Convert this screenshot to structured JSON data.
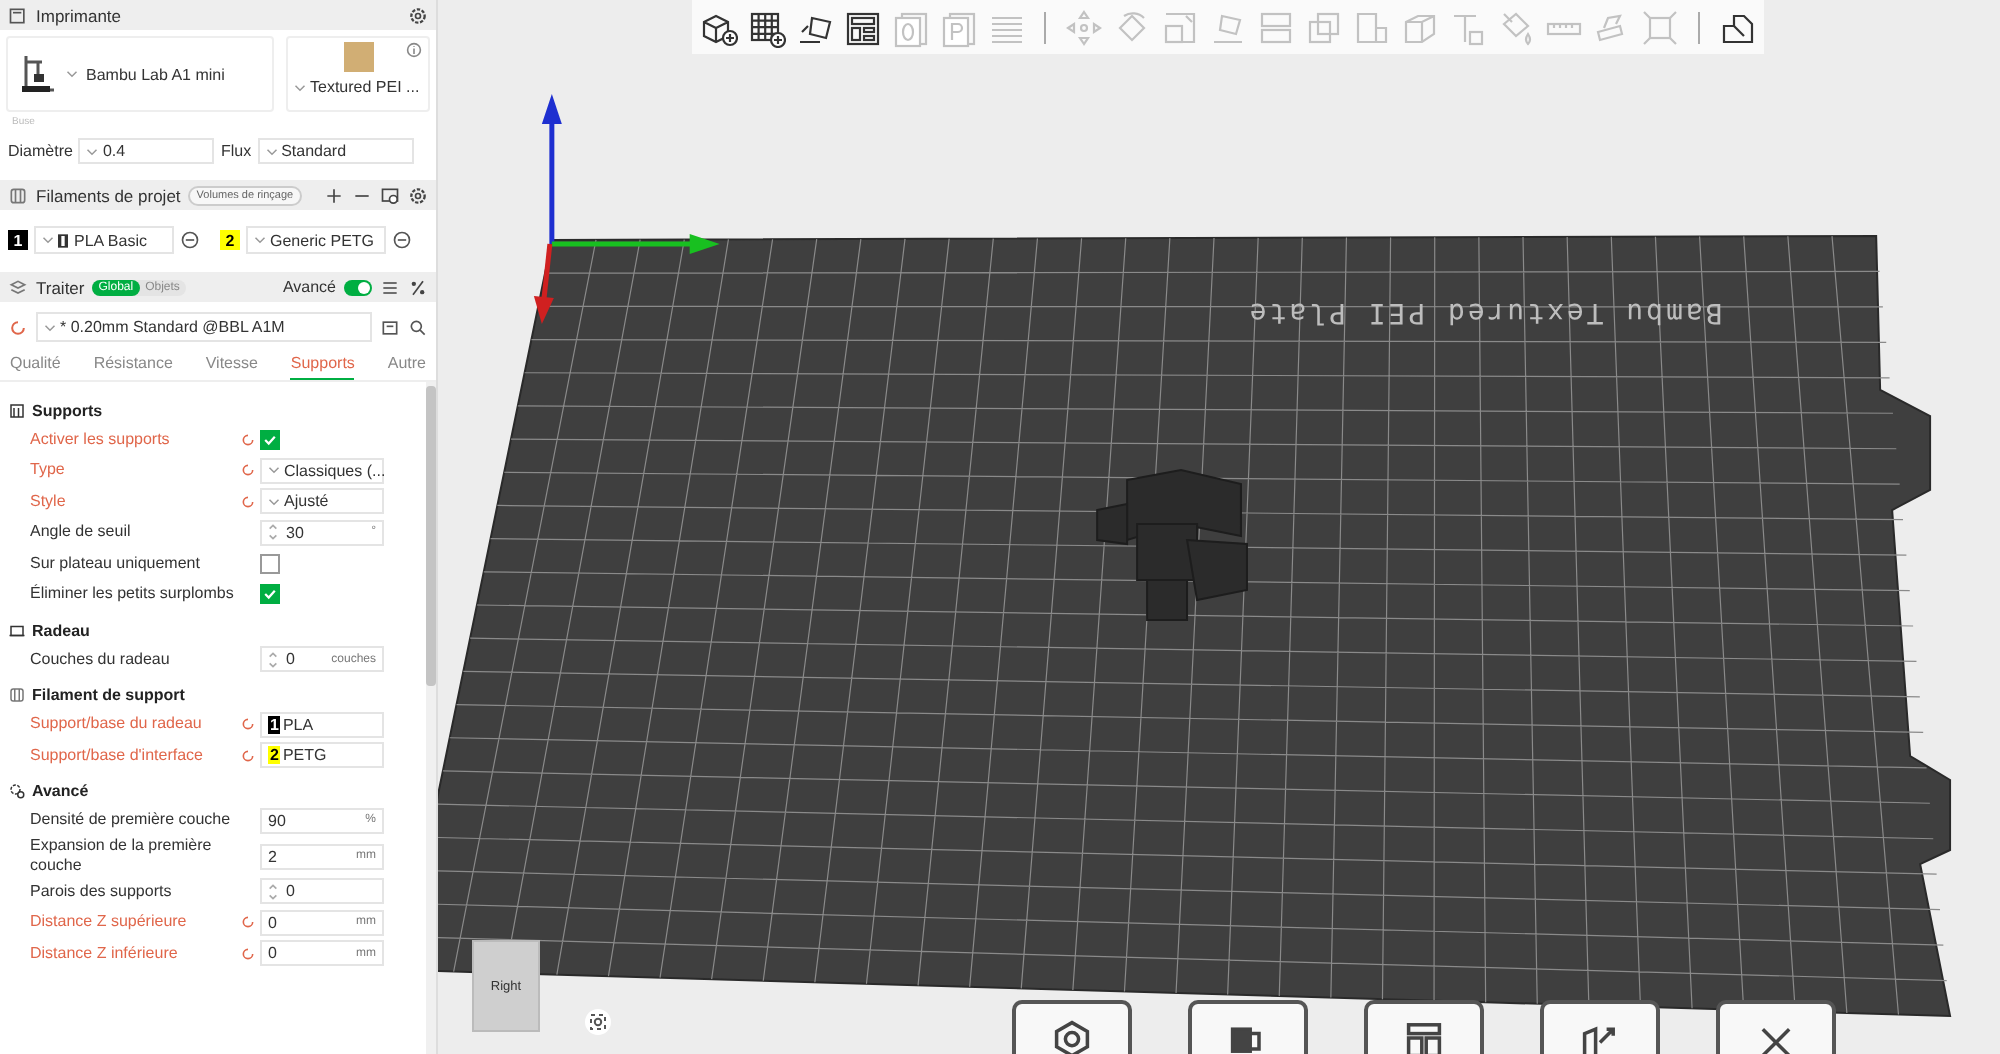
{
  "printer": {
    "title": "Imprimante",
    "name": "Bambu Lab A1 mini",
    "plate": "Textured PEI ...",
    "nozzle_caption": "Buse",
    "diameter_label": "Diamètre",
    "diameter": "0.4",
    "flux_label": "Flux",
    "flux": "Standard"
  },
  "filaments": {
    "title": "Filaments de projet",
    "flush_button": "Volumes de rinçage",
    "items": [
      {
        "number": "1",
        "name": "PLA Basic",
        "color": "#000000"
      },
      {
        "number": "2",
        "name": "Generic PETG",
        "color": "#ffff00"
      }
    ]
  },
  "process": {
    "title": "Traiter",
    "scope": [
      {
        "label": "Global",
        "selected": true
      },
      {
        "label": "Objets",
        "selected": false
      }
    ],
    "advanced_label": "Avancé",
    "advanced_on": true,
    "preset": "* 0.20mm Standard @BBL A1M"
  },
  "tabs": [
    {
      "label": "Qualité",
      "selected": false
    },
    {
      "label": "Résistance",
      "selected": false
    },
    {
      "label": "Vitesse",
      "selected": false
    },
    {
      "label": "Supports",
      "selected": true
    },
    {
      "label": "Autre",
      "selected": false
    }
  ],
  "groups": [
    {
      "title": "Supports",
      "kind": "supports",
      "rows": [
        {
          "label": "Activer les supports",
          "modified": true,
          "kind": "check",
          "checked": true
        },
        {
          "label": "Type",
          "modified": true,
          "kind": "select",
          "value": "Classiques (..."
        },
        {
          "label": "Style",
          "modified": true,
          "kind": "select",
          "value": "Ajusté"
        },
        {
          "label": "Angle de seuil",
          "modified": false,
          "kind": "spin",
          "value": "30",
          "unit": "°"
        },
        {
          "label": "Sur plateau uniquement",
          "modified": false,
          "kind": "check",
          "checked": false
        },
        {
          "label": "Éliminer les petits surplombs",
          "modified": false,
          "kind": "check",
          "checked": true
        }
      ]
    },
    {
      "title": "Radeau",
      "kind": "raft",
      "rows": [
        {
          "label": "Couches du radeau",
          "modified": false,
          "kind": "spin",
          "value": "0",
          "unit": "couches"
        }
      ]
    },
    {
      "title": "Filament de support",
      "kind": "filament",
      "rows": [
        {
          "label": "Support/base du radeau",
          "modified": true,
          "kind": "filament",
          "number": "1",
          "color": "#000000",
          "value": "PLA"
        },
        {
          "label": "Support/base d'interface",
          "modified": true,
          "kind": "filament",
          "number": "2",
          "color": "#ffff00",
          "value": "PETG"
        }
      ]
    },
    {
      "title": "Avancé",
      "kind": "advanced",
      "rows": [
        {
          "label": "Densité de première couche",
          "modified": false,
          "kind": "number",
          "value": "90",
          "unit": "%"
        },
        {
          "label": "Expansion de la première couche",
          "modified": false,
          "kind": "number",
          "value": "2",
          "unit": "mm"
        },
        {
          "label": "Parois des supports",
          "modified": false,
          "kind": "spin",
          "value": "0"
        },
        {
          "label": "Distance Z supérieure",
          "modified": true,
          "kind": "number",
          "value": "0",
          "unit": "mm"
        },
        {
          "label": "Distance Z inférieure",
          "modified": true,
          "kind": "number",
          "value": "0",
          "unit": "mm"
        }
      ]
    }
  ],
  "toolbar": [
    {
      "kind": "add-cube",
      "disabled": false
    },
    {
      "kind": "add-grid",
      "disabled": false
    },
    {
      "kind": "orient",
      "disabled": false
    },
    {
      "kind": "layout",
      "disabled": false
    },
    {
      "kind": "plate-zero",
      "disabled": true
    },
    {
      "kind": "plate-p",
      "disabled": true
    },
    {
      "kind": "layers",
      "disabled": true
    },
    {
      "kind": "separator"
    },
    {
      "kind": "move",
      "disabled": true
    },
    {
      "kind": "rotate",
      "disabled": true
    },
    {
      "kind": "scale",
      "disabled": true
    },
    {
      "kind": "lay-flat",
      "disabled": true
    },
    {
      "kind": "cut",
      "disabled": true
    },
    {
      "kind": "boolean",
      "disabled": true
    },
    {
      "kind": "split",
      "disabled": true
    },
    {
      "kind": "cube",
      "disabled": true
    },
    {
      "kind": "text",
      "disabled": true
    },
    {
      "kind": "paint",
      "disabled": true
    },
    {
      "kind": "ruler",
      "disabled": true
    },
    {
      "kind": "assembly",
      "disabled": true
    },
    {
      "kind": "fit",
      "disabled": true
    },
    {
      "kind": "separator"
    },
    {
      "kind": "puzzle",
      "disabled": false
    }
  ],
  "viewport": {
    "plate_label": "Bambu Textured PEI Plate",
    "view_cube": "Right"
  },
  "bottom_bar": [
    {
      "kind": "nut"
    },
    {
      "kind": "orient"
    },
    {
      "kind": "arrange"
    },
    {
      "kind": "auto"
    },
    {
      "kind": "close"
    }
  ]
}
